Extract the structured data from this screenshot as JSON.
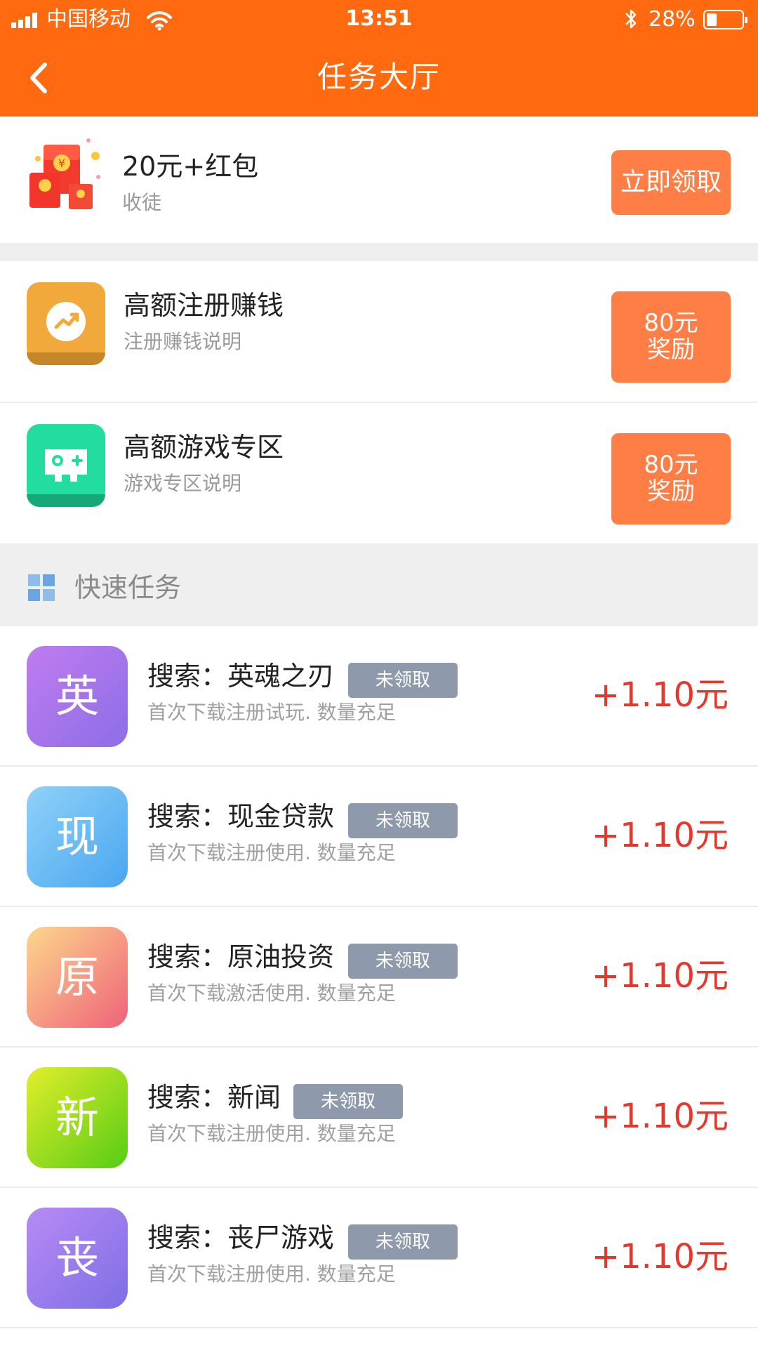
{
  "status_bar": {
    "carrier": "中国移动",
    "time": "13:51",
    "battery": "28%",
    "battery_level": 0.28
  },
  "nav": {
    "title": "任务大厅",
    "back_icon": "chevron-left-icon"
  },
  "invite": {
    "title": "20元+红包",
    "subtitle": "收徒",
    "button": "立即领取",
    "icon": "red-envelope-icon"
  },
  "features": [
    {
      "title": "高额注册赚钱",
      "subtitle": "注册赚钱说明",
      "reward_line1": "80元",
      "reward_line2": "奖励",
      "icon": "trend-chart-icon",
      "color": "#f0a93a"
    },
    {
      "title": "高额游戏专区",
      "subtitle": "游戏专区说明",
      "reward_line1": "80元",
      "reward_line2": "奖励",
      "icon": "gamepad-icon",
      "color": "#23dca0"
    }
  ],
  "quick": {
    "title": "快速任务",
    "icon": "grid-icon"
  },
  "tasks": [
    {
      "initial": "英",
      "name": "搜索：英魂之刃",
      "badge": "未领取",
      "desc": "首次下载注册试玩. 数量充足",
      "reward": "+1.10元",
      "colors": [
        "#c07cf0",
        "#8c6ee6"
      ]
    },
    {
      "initial": "现",
      "name": "搜索：现金贷款",
      "badge": "未领取",
      "desc": "首次下载注册使用. 数量充足",
      "reward": "+1.10元",
      "colors": [
        "#8fd2f8",
        "#4aa6f0"
      ]
    },
    {
      "initial": "原",
      "name": "搜索：原油投资",
      "badge": "未领取",
      "desc": "首次下载激活使用. 数量充足",
      "reward": "+1.10元",
      "colors": [
        "#fcd78c",
        "#f0627a"
      ]
    },
    {
      "initial": "新",
      "name": "搜索：新闻",
      "badge": "未领取",
      "desc": "首次下载注册使用. 数量充足",
      "reward": "+1.10元",
      "colors": [
        "#e2ee2a",
        "#56cc16"
      ]
    },
    {
      "initial": "丧",
      "name": "搜索：丧尸游戏",
      "badge": "未领取",
      "desc": "首次下载注册使用. 数量充足",
      "reward": "+1.10元",
      "colors": [
        "#b88af4",
        "#7e6fe6"
      ]
    }
  ]
}
